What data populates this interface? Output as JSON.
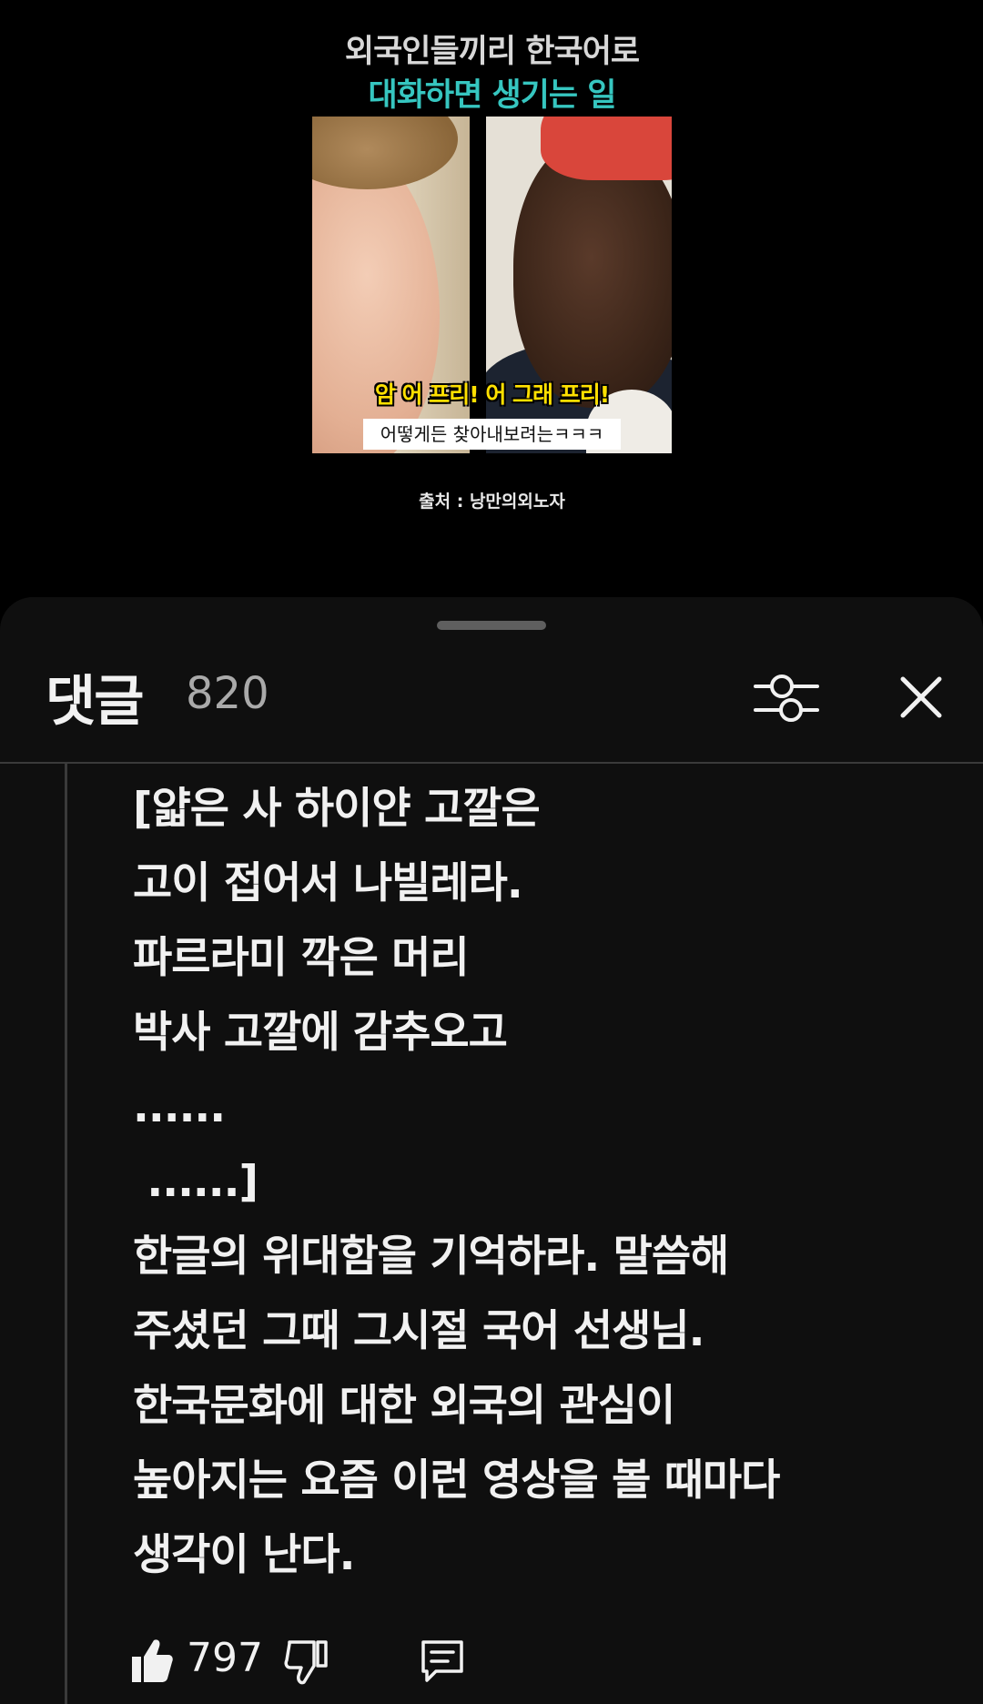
{
  "video": {
    "title_line1": "외국인들끼리 한국어로",
    "title_line2": "대화하면 생기는 일",
    "subtitle_yellow": "암 어 프리!  어 그래 프리!",
    "subtitle_white": "어떻게든 찾아내보려는ㅋㅋㅋ",
    "credit": "출처 : 낭만의외노자"
  },
  "comments_panel": {
    "title": "댓글",
    "count": "820",
    "filter_icon": "filter-sliders-icon",
    "close_icon": "close-icon"
  },
  "comment": {
    "lines": [
      "[얇은 사 하이얀 고깔은",
      "고이 접어서 나빌레라.",
      "파르라미 깍은 머리",
      "박사 고깔에 감추오고",
      "......",
      " ......]",
      "한글의 위대함을 기억하라. 말씀해",
      "주셨던 그때 그시절 국어 선생님.",
      "한국문화에 대한 외국의 관심이",
      "높아지는 요즘 이런 영상을 볼 때마다",
      "생각이 난다."
    ],
    "like_count": "797",
    "like_icon": "thumbs-up-icon",
    "dislike_icon": "thumbs-down-icon",
    "reply_icon": "reply-comment-icon"
  },
  "colors": {
    "sheet_bg": "#0f0f0f",
    "title_accent": "#36c6c0",
    "subtitle_yellow": "#ffe000"
  }
}
